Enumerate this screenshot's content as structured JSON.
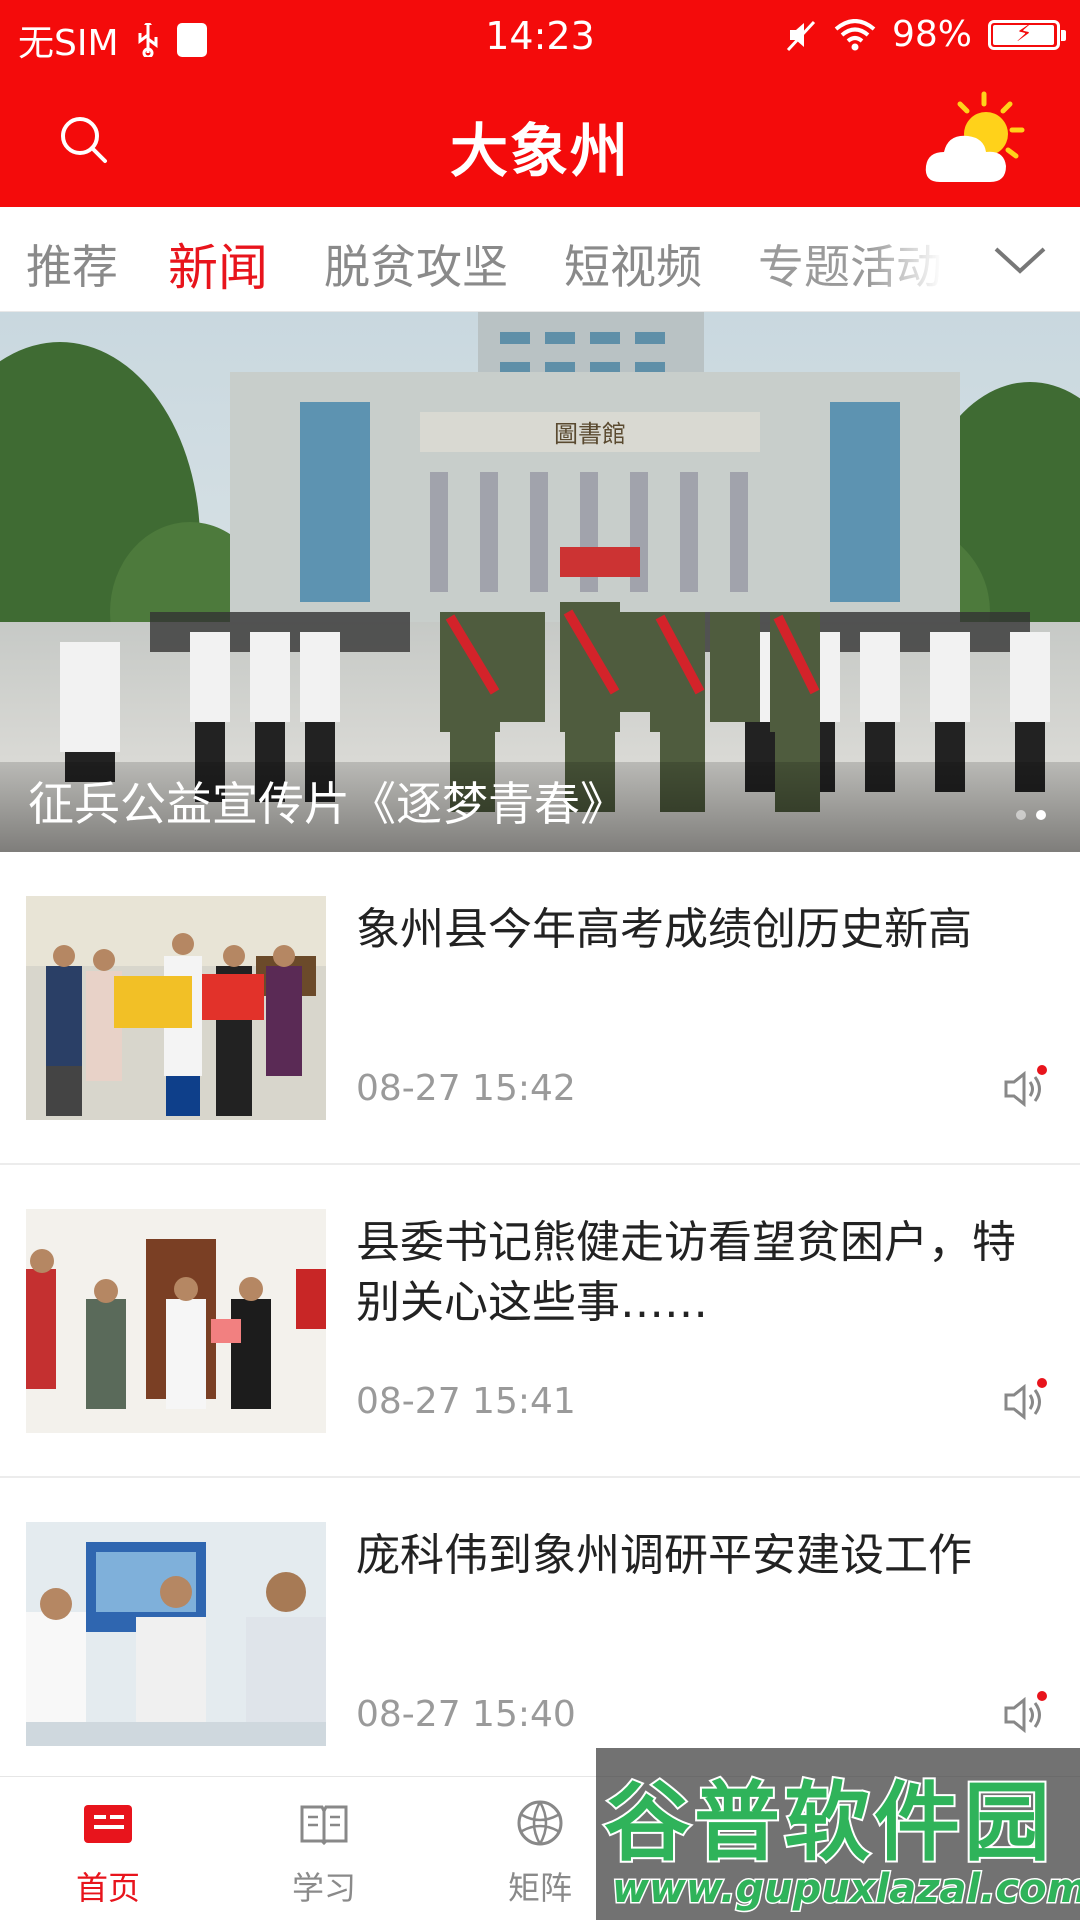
{
  "status_bar": {
    "carrier": "无SIM",
    "time": "14:23",
    "battery": "98%",
    "battery_level": 0.98
  },
  "header": {
    "title": "大象州"
  },
  "tabs": [
    "推荐",
    "新闻",
    "脱贫攻坚",
    "短视频",
    "专题活动"
  ],
  "active_tab_index": 1,
  "banner": {
    "caption": "征兵公益宣传片《逐梦青春》",
    "building_sign": "圖書館"
  },
  "news": [
    {
      "title": "象州县今年高考成绩创历史新高",
      "time": "08-27 15:42"
    },
    {
      "title": "县委书记熊健走访看望贫困户，特别关心这些事……",
      "time": "08-27 15:41"
    },
    {
      "title": "庞科伟到象州调研平安建设工作",
      "time": "08-27 15:40"
    }
  ],
  "bottom_nav": [
    {
      "label": "首页",
      "icon": "home-icon"
    },
    {
      "label": "学习",
      "icon": "book-icon"
    },
    {
      "label": "矩阵",
      "icon": "globe-icon"
    }
  ],
  "watermark": {
    "logo": "谷普软件园",
    "url": "www.gupuxlazal.com"
  },
  "colors": {
    "brand_red": "#f40b0b",
    "active_red": "#e8141c",
    "watermark_green": "#2fb35a"
  }
}
